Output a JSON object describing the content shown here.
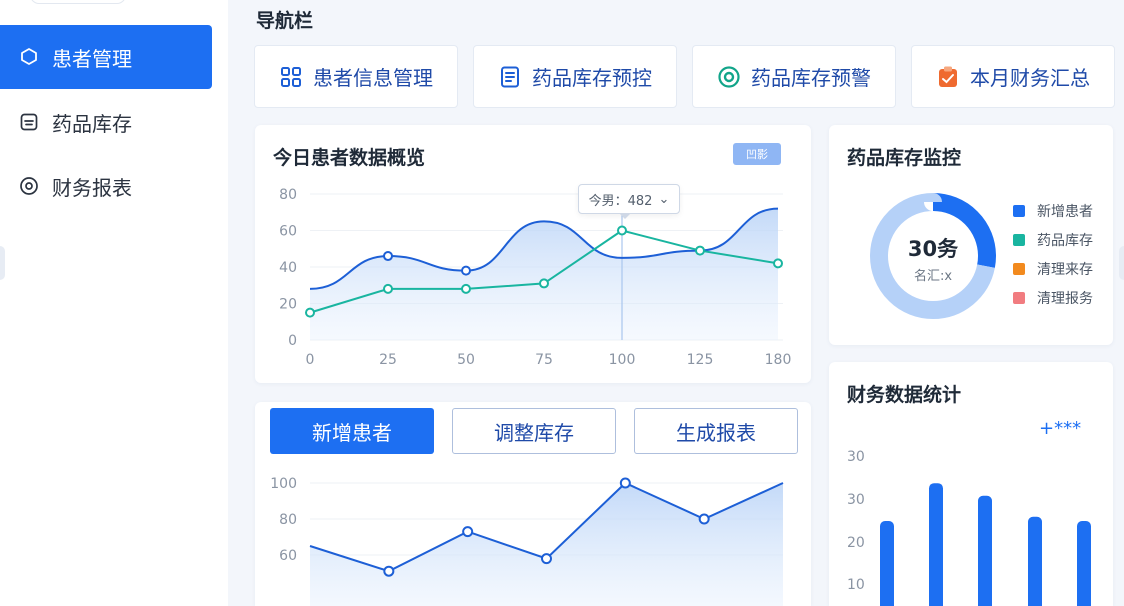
{
  "sidebar": {
    "items": [
      {
        "label": "患者管理",
        "icon": "chat-bubble-icon",
        "active": true
      },
      {
        "label": "药品库存",
        "icon": "inbox-icon",
        "active": false
      },
      {
        "label": "财务报表",
        "icon": "target-circle-icon",
        "active": false
      }
    ]
  },
  "nav": {
    "title": "导航栏"
  },
  "quick_links": [
    {
      "label": "患者信息管理",
      "icon": "grid-icon",
      "color": "#1d5fd6"
    },
    {
      "label": "药品库存预控",
      "icon": "document-icon",
      "color": "#1d5fd6"
    },
    {
      "label": "药品库存预警",
      "icon": "eye-target-icon",
      "color": "#12a58a"
    },
    {
      "label": "本月财务汇总",
      "icon": "clipboard-icon",
      "color": "#ef6a2f"
    }
  ],
  "overview": {
    "title": "今日患者数据概览",
    "badge": "凹影",
    "tooltip": "今男：482",
    "chart_data": {
      "type": "area",
      "x": [
        0,
        25,
        50,
        75,
        100,
        125,
        180
      ],
      "x_tick_labels": [
        "0",
        "25",
        "50",
        "75",
        "100",
        "125",
        "180"
      ],
      "y_ticks": [
        "0",
        "20",
        "40",
        "60",
        "80"
      ],
      "ylim": [
        0,
        80
      ],
      "series": [
        {
          "color": "#1d5fd6",
          "values": [
            28,
            46,
            38,
            65,
            45,
            49,
            72
          ],
          "markers": [
            false,
            true,
            true,
            false,
            false,
            false,
            false
          ]
        },
        {
          "color": "#19b5a0",
          "values": [
            15,
            28,
            28,
            31,
            60,
            49,
            42
          ],
          "markers": [
            true,
            true,
            true,
            true,
            true,
            true,
            true
          ]
        }
      ]
    }
  },
  "actions": {
    "add_patient": "新增患者",
    "adjust_stock": "调整库存",
    "generate_report": "生成报表"
  },
  "trend": {
    "chart_data": {
      "type": "area",
      "y_ticks": [
        "60",
        "80",
        "100"
      ],
      "ylim": [
        45,
        110
      ],
      "values": [
        65,
        51,
        73,
        58,
        100,
        80,
        100
      ],
      "markers": [
        false,
        true,
        true,
        true,
        true,
        true,
        false
      ],
      "color": "#1d5fd6"
    }
  },
  "stock_monitor": {
    "title": "药品库存监控",
    "center_value": "30务",
    "center_label": "名汇:x",
    "chart_data": {
      "type": "pie",
      "slices": [
        {
          "label": "新增患者",
          "value": 28,
          "color": "#1d6ff2"
        },
        {
          "label": "药品库存",
          "value": 72,
          "color": "#b5d1f8"
        }
      ],
      "legend": [
        {
          "label": "新增患者",
          "color": "#1d6ff2"
        },
        {
          "label": "药品库存",
          "color": "#19b5a0"
        },
        {
          "label": "清理来存",
          "color": "#f28a1e"
        },
        {
          "label": "清理报务",
          "color": "#f17c80"
        }
      ]
    }
  },
  "finance": {
    "title": "财务数据统计",
    "stars": "+***",
    "chart_data": {
      "type": "bar",
      "y_tick_labels": [
        "30",
        "30",
        "20",
        "10"
      ],
      "ylim": [
        10,
        32
      ],
      "values": [
        25,
        34,
        31,
        26,
        25
      ],
      "color": "#1d6ff2"
    }
  }
}
